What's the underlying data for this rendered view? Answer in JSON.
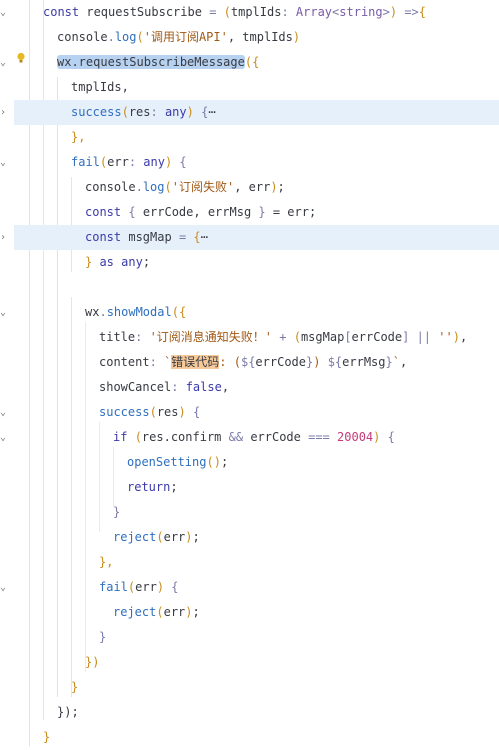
{
  "editor": {
    "lines": [
      {
        "id": "l1",
        "hl": false,
        "tokens": [
          [
            "k",
            "const "
          ],
          [
            "",
            "requestSubscribe "
          ],
          [
            "o",
            "= "
          ],
          [
            "p",
            "("
          ],
          [
            "",
            "tmplIds"
          ],
          [
            "o",
            ": "
          ],
          [
            "t",
            "Array"
          ],
          [
            "o",
            "<"
          ],
          [
            "t",
            "string"
          ],
          [
            "o",
            ">"
          ],
          [
            "p",
            ")"
          ],
          [
            "o",
            " =>"
          ],
          [
            "p",
            "{"
          ]
        ]
      },
      {
        "id": "l2",
        "hl": false,
        "tokens": [
          [
            "",
            "console"
          ],
          [
            "o",
            "."
          ],
          [
            "fn",
            "log"
          ],
          [
            "p",
            "("
          ],
          [
            "s",
            "'调用订阅API'"
          ],
          [
            "",
            ", tmplIds"
          ],
          [
            "p",
            ")"
          ]
        ]
      },
      {
        "id": "l3",
        "hl": false,
        "tokens": [
          [
            "wx",
            "wx.requestSubscribeMessage"
          ],
          [
            "p",
            "({"
          ]
        ]
      },
      {
        "id": "l4",
        "hl": false,
        "tokens": [
          [
            "",
            "tmplIds,"
          ]
        ]
      },
      {
        "id": "l5",
        "hl": true,
        "tokens": [
          [
            "fn",
            "success"
          ],
          [
            "p",
            "("
          ],
          [
            "",
            "res"
          ],
          [
            "o",
            ": "
          ],
          [
            "k",
            "any"
          ],
          [
            "p",
            ")"
          ],
          [
            "o",
            " {"
          ],
          [
            "",
            "⋯"
          ]
        ]
      },
      {
        "id": "l6",
        "hl": false,
        "tokens": [
          [
            "p",
            "},"
          ]
        ]
      },
      {
        "id": "l7",
        "hl": false,
        "tokens": [
          [
            "fn",
            "fail"
          ],
          [
            "p",
            "("
          ],
          [
            "",
            "err"
          ],
          [
            "o",
            ": "
          ],
          [
            "k",
            "any"
          ],
          [
            "p",
            ")"
          ],
          [
            "o",
            " {"
          ]
        ]
      },
      {
        "id": "l8",
        "hl": false,
        "tokens": [
          [
            "",
            "console"
          ],
          [
            "o",
            "."
          ],
          [
            "fn",
            "log"
          ],
          [
            "p",
            "("
          ],
          [
            "s",
            "'订阅失败'"
          ],
          [
            "",
            ", err"
          ],
          [
            "p",
            ")"
          ],
          [
            "",
            ";"
          ]
        ]
      },
      {
        "id": "l9",
        "hl": false,
        "tokens": [
          [
            "k",
            "const "
          ],
          [
            "o",
            "{ "
          ],
          [
            "",
            "errCode, errMsg "
          ],
          [
            "o",
            "} "
          ],
          [
            "",
            "= err;"
          ]
        ]
      },
      {
        "id": "l10",
        "hl": true,
        "tokens": [
          [
            "k",
            "const "
          ],
          [
            "",
            "msgMap "
          ],
          [
            "o",
            "= "
          ],
          [
            "p",
            "{"
          ],
          [
            "",
            "⋯"
          ]
        ]
      },
      {
        "id": "l11",
        "hl": false,
        "tokens": [
          [
            "p",
            "} "
          ],
          [
            "k",
            "as any"
          ],
          [
            "",
            ";"
          ]
        ]
      },
      {
        "id": "l12",
        "hl": false,
        "tokens": []
      },
      {
        "id": "l13",
        "hl": false,
        "tokens": [
          [
            "",
            "wx"
          ],
          [
            "o",
            "."
          ],
          [
            "fn",
            "showModal"
          ],
          [
            "p",
            "({"
          ]
        ]
      },
      {
        "id": "l14",
        "hl": false,
        "tokens": [
          [
            "",
            "title"
          ],
          [
            "o",
            ": "
          ],
          [
            "s",
            "'订阅消息通知失败！' "
          ],
          [
            "o",
            "+ "
          ],
          [
            "p",
            "("
          ],
          [
            "",
            "msgMap"
          ],
          [
            "o",
            "["
          ],
          [
            "",
            "errCode"
          ],
          [
            "o",
            "] || "
          ],
          [
            "s",
            "''"
          ],
          [
            "p",
            ")"
          ],
          [
            "",
            ","
          ]
        ]
      },
      {
        "id": "l15",
        "hl": false,
        "tokens": [
          [
            "",
            "content"
          ],
          [
            "o",
            ": "
          ],
          [
            "s",
            "`"
          ],
          [
            "cn",
            "错误代码"
          ],
          [
            "s",
            ": ("
          ],
          [
            "o",
            "${"
          ],
          [
            "",
            "errCode"
          ],
          [
            "o",
            "}"
          ],
          [
            "s",
            ") "
          ],
          [
            "o",
            "${"
          ],
          [
            "",
            "errMsg"
          ],
          [
            "o",
            "}"
          ],
          [
            "s",
            "`"
          ],
          [
            "",
            ","
          ]
        ]
      },
      {
        "id": "l16",
        "hl": false,
        "tokens": [
          [
            "",
            "showCancel"
          ],
          [
            "o",
            ": "
          ],
          [
            "k",
            "false"
          ],
          [
            "",
            ","
          ]
        ]
      },
      {
        "id": "l17",
        "hl": false,
        "tokens": [
          [
            "fn",
            "success"
          ],
          [
            "p",
            "("
          ],
          [
            "",
            "res"
          ],
          [
            "p",
            ")"
          ],
          [
            "o",
            " {"
          ]
        ]
      },
      {
        "id": "l18",
        "hl": false,
        "tokens": [
          [
            "k",
            "if "
          ],
          [
            "p",
            "("
          ],
          [
            "",
            "res.confirm "
          ],
          [
            "o",
            "&& "
          ],
          [
            "",
            "errCode "
          ],
          [
            "o",
            "=== "
          ],
          [
            "n",
            "20004"
          ],
          [
            "p",
            ")"
          ],
          [
            "o",
            " {"
          ]
        ]
      },
      {
        "id": "l19",
        "hl": false,
        "tokens": [
          [
            "fn",
            "openSetting"
          ],
          [
            "p",
            "()"
          ],
          [
            "",
            ";"
          ]
        ]
      },
      {
        "id": "l20",
        "hl": false,
        "tokens": [
          [
            "k",
            "return"
          ],
          [
            "",
            ";"
          ]
        ]
      },
      {
        "id": "l21",
        "hl": false,
        "tokens": [
          [
            "o",
            "}"
          ]
        ]
      },
      {
        "id": "l22",
        "hl": false,
        "tokens": [
          [
            "fn",
            "reject"
          ],
          [
            "p",
            "("
          ],
          [
            "",
            "err"
          ],
          [
            "p",
            ")"
          ],
          [
            "",
            ";"
          ]
        ]
      },
      {
        "id": "l23",
        "hl": false,
        "tokens": [
          [
            "p",
            "},"
          ]
        ]
      },
      {
        "id": "l24",
        "hl": false,
        "tokens": [
          [
            "fn",
            "fail"
          ],
          [
            "p",
            "("
          ],
          [
            "",
            "err"
          ],
          [
            "p",
            ")"
          ],
          [
            "o",
            " {"
          ]
        ]
      },
      {
        "id": "l25",
        "hl": false,
        "tokens": [
          [
            "fn",
            "reject"
          ],
          [
            "p",
            "("
          ],
          [
            "",
            "err"
          ],
          [
            "p",
            ")"
          ],
          [
            "",
            ";"
          ]
        ]
      },
      {
        "id": "l26",
        "hl": false,
        "tokens": [
          [
            "o",
            "}"
          ]
        ]
      },
      {
        "id": "l27",
        "hl": false,
        "tokens": [
          [
            "p",
            "})"
          ]
        ]
      },
      {
        "id": "l28",
        "hl": false,
        "tokens": [
          [
            "p",
            "}"
          ]
        ]
      },
      {
        "id": "l29",
        "hl": false,
        "tokens": [
          [
            "",
            "});"
          ]
        ]
      },
      {
        "id": "l30",
        "hl": false,
        "tokens": [
          [
            "p",
            "}"
          ]
        ]
      }
    ],
    "gutter_marks": [
      {
        "line": 1,
        "icon": "fold-open-icon",
        "glyph": "⌄"
      },
      {
        "line": 3,
        "icon": "fold-open-icon",
        "glyph": "⌄"
      },
      {
        "line": 5,
        "icon": "fold-closed-icon",
        "glyph": "›"
      },
      {
        "line": 7,
        "icon": "fold-open-icon",
        "glyph": "⌄"
      },
      {
        "line": 10,
        "icon": "fold-closed-icon",
        "glyph": "›"
      },
      {
        "line": 13,
        "icon": "fold-open-icon",
        "glyph": "⌄"
      },
      {
        "line": 17,
        "icon": "fold-open-icon",
        "glyph": "⌄"
      },
      {
        "line": 18,
        "icon": "fold-open-icon",
        "glyph": "⌄"
      },
      {
        "line": 24,
        "icon": "fold-open-icon",
        "glyph": "⌄"
      }
    ],
    "lightbulb_icon": "lightbulb-icon"
  }
}
